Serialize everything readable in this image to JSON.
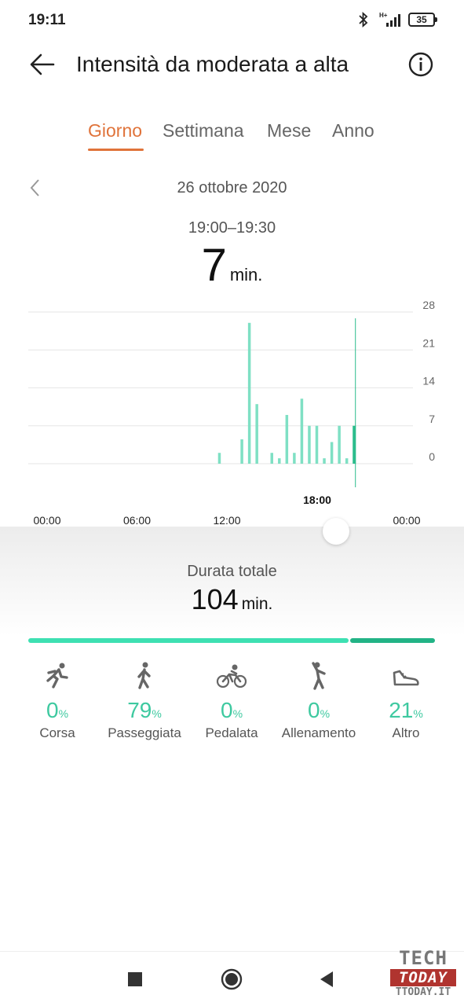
{
  "status_bar": {
    "time": "19:11",
    "battery": "35",
    "network": "H+"
  },
  "header": {
    "title": "Intensità da moderata a alta",
    "back_icon": "arrow-left-icon",
    "info_icon": "info-circle-icon"
  },
  "tabs": [
    {
      "label": "Giorno",
      "active": true
    },
    {
      "label": "Settimana",
      "active": false
    },
    {
      "label": "Mese",
      "active": false
    },
    {
      "label": "Anno",
      "active": false
    }
  ],
  "date_nav": {
    "date": "26 ottobre 2020"
  },
  "selection": {
    "range": "19:00–19:30",
    "value": "7",
    "unit": "min."
  },
  "chart_data": {
    "type": "bar",
    "y_ticks": [
      "28",
      "21",
      "14",
      "7",
      "0"
    ],
    "ylim": [
      0,
      28
    ],
    "x_tick_labels": [
      "00:00",
      "06:00",
      "12:00",
      "18:00",
      "00:00"
    ],
    "selected_label": "18:00",
    "bar_color": "#7fe0c4",
    "selected_color": "#2bbd8c",
    "bins": [
      {
        "t": 11.5,
        "v": 2
      },
      {
        "t": 13,
        "v": 4.5
      },
      {
        "t": 13.5,
        "v": 26
      },
      {
        "t": 14,
        "v": 11
      },
      {
        "t": 15,
        "v": 2
      },
      {
        "t": 15.5,
        "v": 1
      },
      {
        "t": 16,
        "v": 9
      },
      {
        "t": 16.5,
        "v": 2
      },
      {
        "t": 17,
        "v": 12
      },
      {
        "t": 17.5,
        "v": 7
      },
      {
        "t": 18,
        "v": 7
      },
      {
        "t": 18.5,
        "v": 1
      },
      {
        "t": 19,
        "v": 4
      },
      {
        "t": 19.5,
        "v": 7
      },
      {
        "t": 20,
        "v": 1
      },
      {
        "t": 20.5,
        "v": 7,
        "selected": true
      }
    ]
  },
  "summary": {
    "label": "Durata totale",
    "value": "104",
    "unit": "min."
  },
  "progress": {
    "walking_fraction": 0.79,
    "other_fraction": 0.21,
    "walking_color": "#3ee0b2",
    "other_color": "#22b386"
  },
  "categories": [
    {
      "pct": "0",
      "label": "Corsa",
      "icon": "running-icon"
    },
    {
      "pct": "79",
      "label": "Passeggiata",
      "icon": "walking-icon"
    },
    {
      "pct": "0",
      "label": "Pedalata",
      "icon": "cycling-icon"
    },
    {
      "pct": "0",
      "label": "Allenamento",
      "icon": "workout-icon"
    },
    {
      "pct": "21",
      "label": "Altro",
      "icon": "shoe-icon"
    }
  ],
  "pct_symbol": "%",
  "watermark": {
    "line1": "TECH",
    "line2": "TODAY",
    "line3": "TTODAY.IT"
  }
}
